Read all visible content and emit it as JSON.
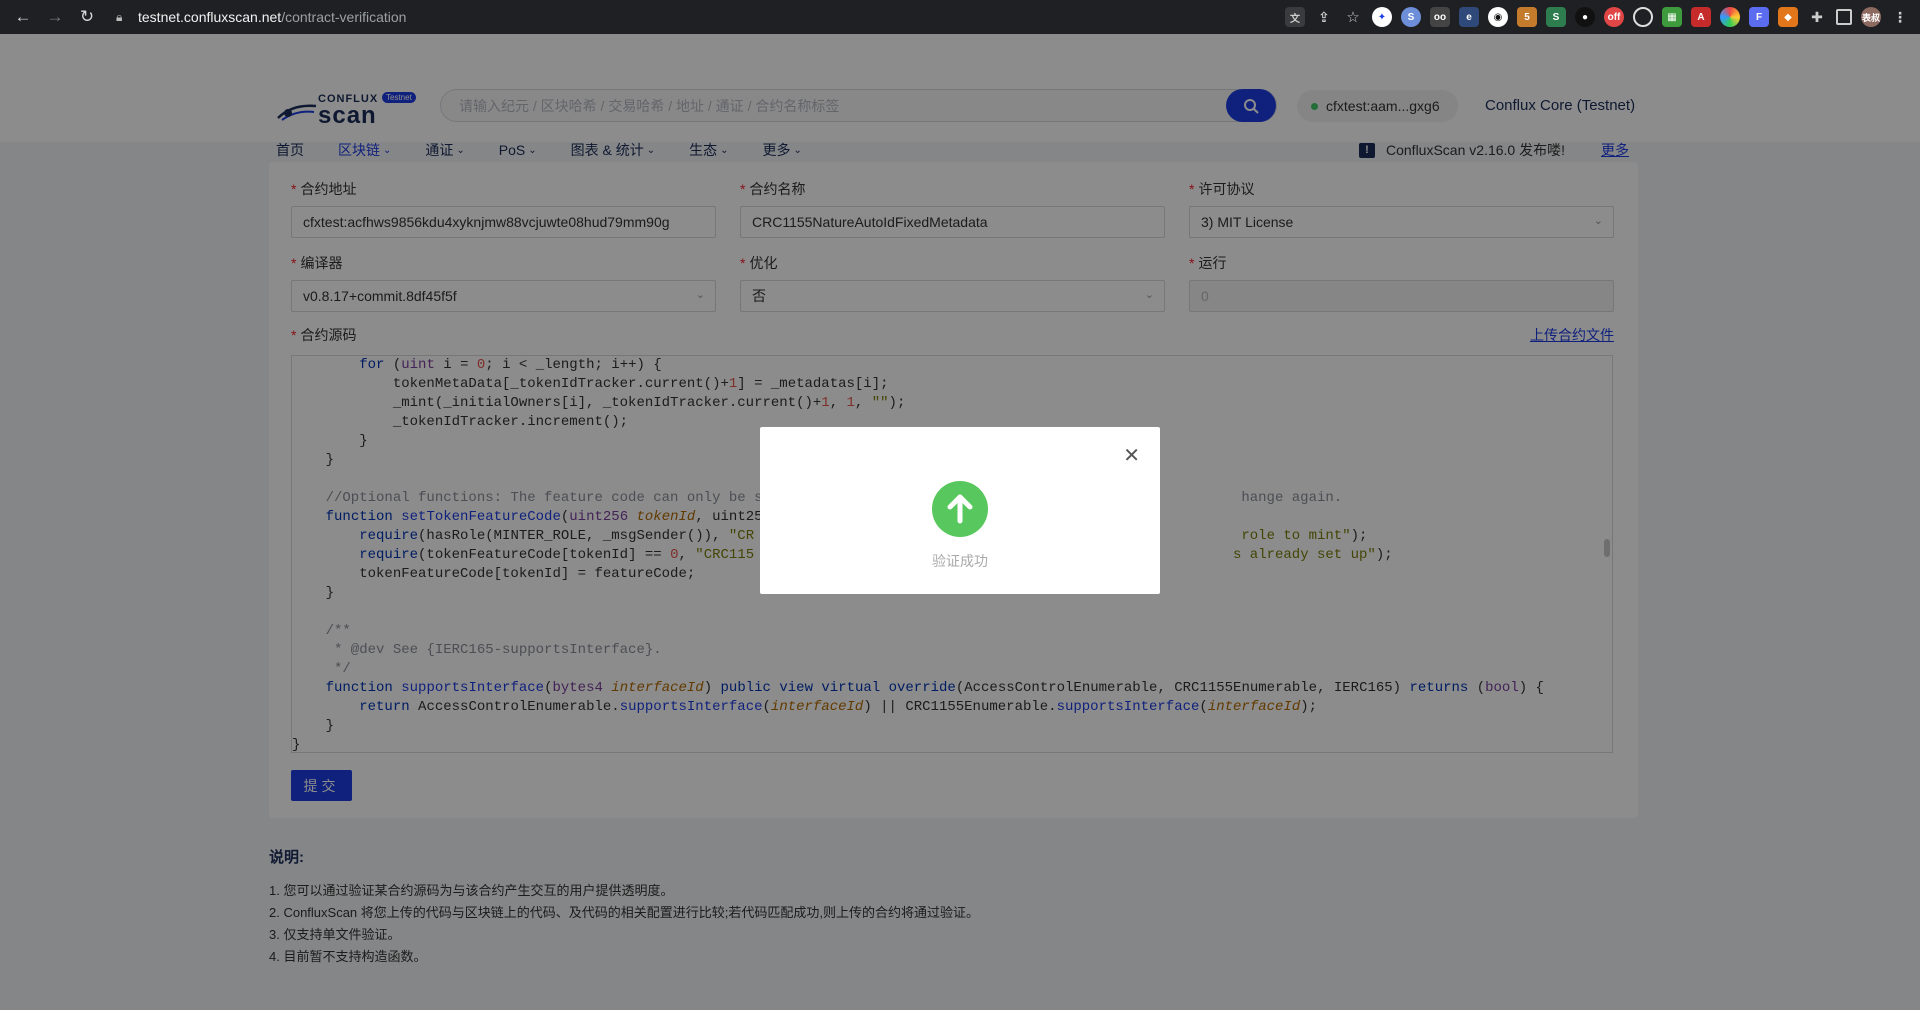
{
  "browser": {
    "url_host": "testnet.confluxscan.net",
    "url_path": "/contract-verification",
    "avatar_text": "表叔"
  },
  "header": {
    "logo_top": "CONFLUX",
    "logo_bottom": "scan",
    "logo_badge": "Testnet",
    "search_placeholder": "请输入纪元 / 区块哈希 / 交易哈希 / 地址 / 通证 / 合约名称标签",
    "wallet": "cfxtest:aam...gxg6",
    "network": "Conflux Core (Testnet)",
    "nav": [
      {
        "label": "首页",
        "dropdown": false
      },
      {
        "label": "区块链",
        "dropdown": true
      },
      {
        "label": "通证",
        "dropdown": true
      },
      {
        "label": "PoS",
        "dropdown": true
      },
      {
        "label": "图表 & 统计",
        "dropdown": true
      },
      {
        "label": "生态",
        "dropdown": true
      },
      {
        "label": "更多",
        "dropdown": true
      }
    ],
    "announcement": "ConfluxScan v2.16.0 发布喽!",
    "announcement_more": "更多"
  },
  "form": {
    "address_label": "合约地址",
    "address_value": "cfxtest:acfhws9856kdu4xyknjmw88vcjuwte08hud79mm90g",
    "name_label": "合约名称",
    "name_value": "CRC1155NatureAutoIdFixedMetadata",
    "license_label": "许可协议",
    "license_value": "3) MIT License",
    "compiler_label": "编译器",
    "compiler_value": "v0.8.17+commit.8df45f5f",
    "optimize_label": "优化",
    "optimize_value": "否",
    "runs_label": "运行",
    "runs_value": "0",
    "source_label": "合约源码",
    "upload_link": "上传合约文件",
    "submit": "提交"
  },
  "code_lines": [
    "        for (uint i = 0; i < _length; i++) {",
    "            tokenMetaData[_tokenIdTracker.current()+1] = _metadatas[i];",
    "            _mint(_initialOwners[i], _tokenIdTracker.current()+1, 1, \"\");",
    "            _tokenIdTracker.increment();",
    "        }",
    "    }",
    "",
    "    //Optional functions: The feature code can only be s                                                         hange again.",
    "    function setTokenFeatureCode(uint256 tokenId, uint25",
    "        require(hasRole(MINTER_ROLE, _msgSender()), \"CR                                                          role to mint\");",
    "        require(tokenFeatureCode[tokenId] == 0, \"CRC115                                                         s already set up\");",
    "        tokenFeatureCode[tokenId] = featureCode;",
    "    }",
    "",
    "    /**",
    "     * @dev See {IERC165-supportsInterface}.",
    "     */",
    "    function supportsInterface(bytes4 interfaceId) public view virtual override(AccessControlEnumerable, CRC1155Enumerable, IERC165) returns (bool) {",
    "        return AccessControlEnumerable.supportsInterface(interfaceId) || CRC1155Enumerable.supportsInterface(interfaceId);",
    "    }",
    "}"
  ],
  "notes": {
    "title": "说明:",
    "items": [
      "1. 您可以通过验证某合约源码为与该合约产生交互的用户提供透明度。",
      "2. ConfluxScan 将您上传的代码与区块链上的代码、及代码的相关配置进行比较;若代码匹配成功,则上传的合约将通过验证。",
      "3. 仅支持单文件验证。",
      "4. 目前暂不支持构造函数。"
    ]
  },
  "modal": {
    "message": "验证成功",
    "icon": "upload-arrow-icon",
    "icon_color": "#58c75d"
  },
  "colors": {
    "primary": "#1e3de4",
    "navy": "#1b2d5a",
    "success": "#58c75d"
  }
}
